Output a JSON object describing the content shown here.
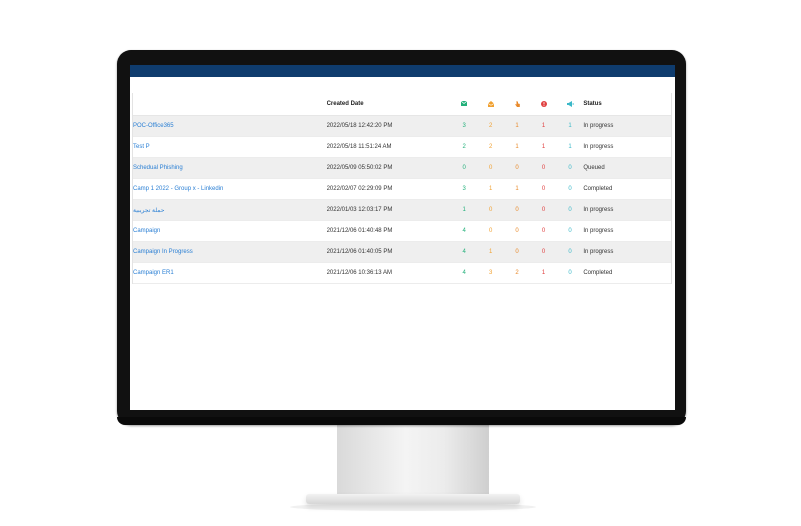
{
  "table": {
    "headers": {
      "name": "",
      "created_date": "Created Date",
      "status": "Status"
    },
    "header_icons": [
      {
        "icon": "envelope-icon",
        "color": "#22b07a"
      },
      {
        "icon": "open-envelope-icon",
        "color": "#f0a030"
      },
      {
        "icon": "pointer-icon",
        "color": "#e8892a"
      },
      {
        "icon": "warning-icon",
        "color": "#e04040"
      },
      {
        "icon": "megaphone-icon",
        "color": "#3ab8c8"
      }
    ],
    "rows": [
      {
        "name": "POC-Office365",
        "date": "2022/05/18 12:42:20 PM",
        "c1": "3",
        "c2": "2",
        "c3": "1",
        "c4": "1",
        "c5": "1",
        "status": "In progress"
      },
      {
        "name": "Test P",
        "date": "2022/05/18 11:51:24 AM",
        "c1": "2",
        "c2": "2",
        "c3": "1",
        "c4": "1",
        "c5": "1",
        "status": "In progress"
      },
      {
        "name": "Schedual Phishing",
        "date": "2022/05/09 05:50:02 PM",
        "c1": "0",
        "c2": "0",
        "c3": "0",
        "c4": "0",
        "c5": "0",
        "status": "Queued"
      },
      {
        "name": "Camp 1 2022 - Group x - Linkedin",
        "date": "2022/02/07 02:29:09 PM",
        "c1": "3",
        "c2": "1",
        "c3": "1",
        "c4": "0",
        "c5": "0",
        "status": "Completed"
      },
      {
        "name": "حملة تجريبية",
        "date": "2022/01/03 12:03:17 PM",
        "c1": "1",
        "c2": "0",
        "c3": "0",
        "c4": "0",
        "c5": "0",
        "status": "In progress"
      },
      {
        "name": "Campaign",
        "date": "2021/12/06 01:40:48 PM",
        "c1": "4",
        "c2": "0",
        "c3": "0",
        "c4": "0",
        "c5": "0",
        "status": "In progress"
      },
      {
        "name": "Campaign In Progress",
        "date": "2021/12/06 01:40:05 PM",
        "c1": "4",
        "c2": "1",
        "c3": "0",
        "c4": "0",
        "c5": "0",
        "status": "In progress"
      },
      {
        "name": "Campaign ER1",
        "date": "2021/12/06 10:36:13 AM",
        "c1": "4",
        "c2": "3",
        "c3": "2",
        "c4": "1",
        "c5": "0",
        "status": "Completed"
      }
    ]
  }
}
